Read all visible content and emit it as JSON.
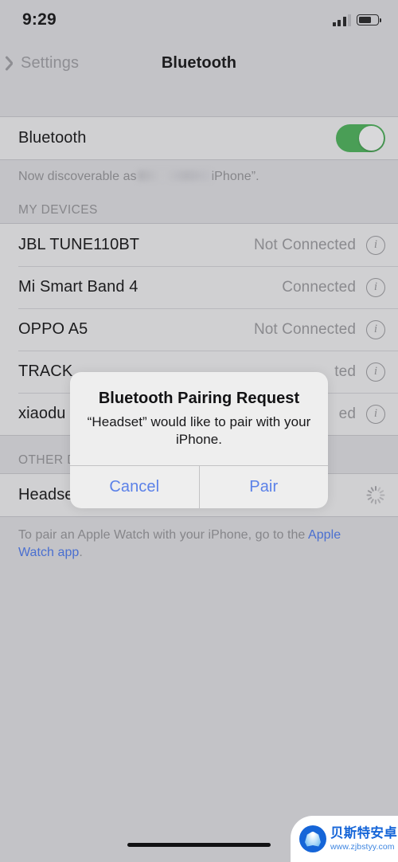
{
  "status_bar": {
    "time": "9:29",
    "signal_icon": "cellular-signal-icon",
    "battery_icon": "battery-icon",
    "signal_bars_filled": 3,
    "signal_bars_total": 4,
    "battery_level_percent": 66
  },
  "nav_bar": {
    "back_label": "Settings",
    "back_icon": "chevron-left-icon",
    "title": "Bluetooth"
  },
  "bluetooth": {
    "label": "Bluetooth",
    "enabled": true,
    "discoverable_note_prefix": "Now discoverable as",
    "discoverable_note_suffix": "iPhone”.",
    "redacted": true
  },
  "my_devices": {
    "header": "MY DEVICES",
    "items": [
      {
        "name": "JBL TUNE110BT",
        "status": "Not Connected",
        "info_icon": "info-circle-icon"
      },
      {
        "name": "Mi Smart Band 4",
        "status": "Connected",
        "info_icon": "info-circle-icon"
      },
      {
        "name": "OPPO A5",
        "status": "Not Connected",
        "info_icon": "info-circle-icon"
      },
      {
        "name": "TRACK",
        "status": "ted",
        "info_icon": "info-circle-icon"
      },
      {
        "name": "xiaodu",
        "status": "ed",
        "info_icon": "info-circle-icon"
      }
    ]
  },
  "other_devices": {
    "header": "OTHER DEVICES",
    "items": [
      {
        "name": "Headset",
        "status": "",
        "spinner_icon": "loading-spinner-icon"
      }
    ],
    "footer_text": "To pair an Apple Watch with your iPhone, go to the ",
    "footer_link": "Apple Watch app",
    "footer_end": "."
  },
  "alert": {
    "title": "Bluetooth Pairing Request",
    "message": "“Headset” would like to pair with your iPhone.",
    "cancel_label": "Cancel",
    "pair_label": "Pair"
  },
  "watermark": {
    "name_cn": "贝斯特安卓网",
    "url": "www.zjbstyy.com",
    "logo_icon": "shell-logo-icon"
  },
  "colors": {
    "background": "#c3c3c7",
    "row_background": "#d0d0d2",
    "toggle_on": "#4a9e56",
    "link": "#4a6fd0",
    "alert_button": "#5b81e8",
    "watermark_blue": "#1565d8"
  }
}
